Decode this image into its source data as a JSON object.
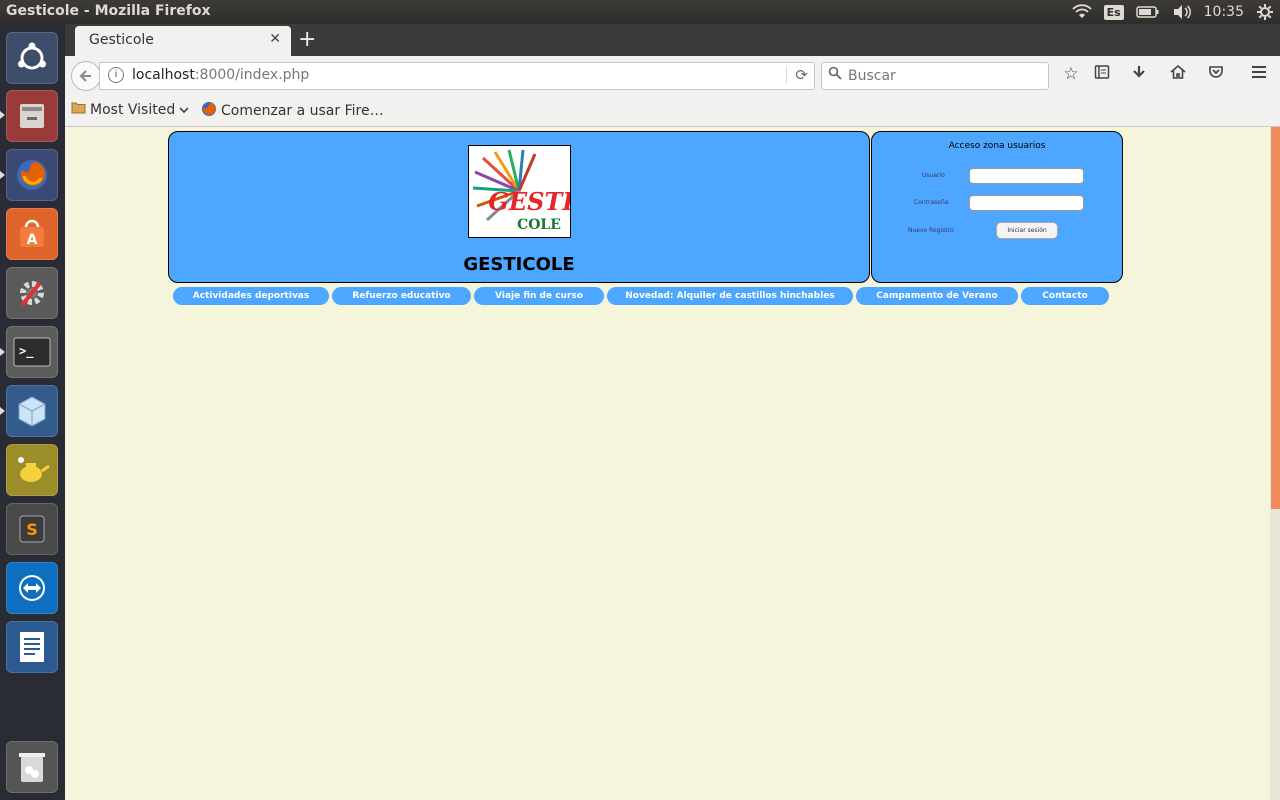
{
  "os": {
    "window_title": "Gesticole - Mozilla Firefox",
    "tray": {
      "language": "Es",
      "clock": "10:35"
    },
    "launcher": [
      "ubuntu-dash-icon",
      "file-manager-icon",
      "firefox-icon",
      "software-center-icon",
      "system-settings-icon",
      "terminal-icon",
      "virtualbox-icon",
      "genie-teapot-icon",
      "sublime-text-icon",
      "teamviewer-icon",
      "libreoffice-writer-icon",
      "trash-icon"
    ]
  },
  "browser": {
    "tab": {
      "title": "Gesticole"
    },
    "url": {
      "host": "localhost",
      "rest": ":8000/index.php"
    },
    "search": {
      "placeholder": "Buscar"
    },
    "bookmarks": {
      "most_visited": "Most Visited",
      "getting_started": "Comenzar a usar Fire…"
    }
  },
  "page": {
    "title": "GESTICOLE",
    "logo": {
      "line1": "GESTI",
      "line2": "COLE"
    },
    "login": {
      "heading": "Acceso zona usuarios",
      "user_label": "Usuario",
      "password_label": "Contraseña",
      "register_label": "Nuevo Registro",
      "button": "Iniciar sesión"
    },
    "menu": [
      "Actividades deportivas",
      "Refuerzo educativo",
      "Viaje fin de curso",
      "Novedad: Alquiler de castillos hinchables",
      "Campamento de Verano",
      "Contacto"
    ]
  },
  "colors": {
    "panel": "#4da6ff",
    "page_bg": "#f5f5dc",
    "scroll_thumb": "#f08a5d"
  }
}
